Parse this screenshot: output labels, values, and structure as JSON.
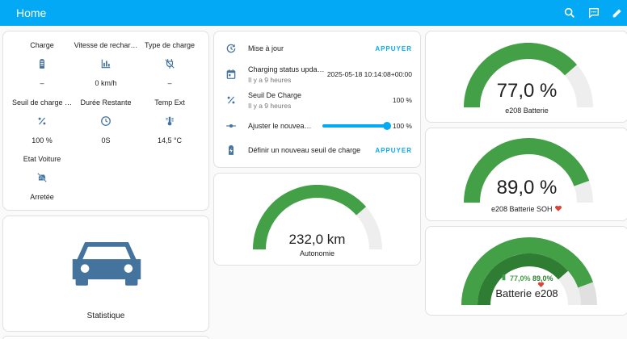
{
  "header": {
    "title": "Home",
    "icons": [
      "search-icon",
      "assist-icon",
      "edit-icon"
    ]
  },
  "status_grid": [
    {
      "label": "Charge",
      "icon": "battery-icon",
      "value": "–"
    },
    {
      "label": "Vitesse de rechar…",
      "icon": "chart-bar-icon",
      "value": "0 km/h"
    },
    {
      "label": "Type de charge",
      "icon": "power-plug-off-icon",
      "value": "–"
    },
    {
      "label": "Seuil de charge …",
      "icon": "percent-icon",
      "value": "100 %"
    },
    {
      "label": "Durée Restante",
      "icon": "clock-icon",
      "value": "0S"
    },
    {
      "label": "Temp Ext",
      "icon": "thermometer-icon",
      "value": "14,5 °C"
    },
    {
      "label": "Etat Voiture",
      "icon": "car-off-icon",
      "value": "Arretée"
    }
  ],
  "statistics": {
    "label": "Statistique",
    "icon": "car-icon"
  },
  "entities": {
    "update": {
      "name": "Mise à jour",
      "button": "APPUYER"
    },
    "charging_status": {
      "name": "Charging status upda…",
      "sub": "Il y a 9 heures",
      "value": "2025-05-18 10:14:08+00:00"
    },
    "threshold": {
      "name": "Seuil De Charge",
      "sub": "Il y a 9 heures",
      "value": "100 %"
    },
    "slider": {
      "name": "Ajuster le nouveau …",
      "value": "100 %",
      "level": 1.0
    },
    "set_threshold": {
      "name": "Définir un nouveau seuil de charge",
      "button": "APPUYER"
    }
  },
  "gauges": {
    "autonomie": {
      "value": "232,0 km",
      "name": "Autonomie",
      "fraction": 0.77
    },
    "battery": {
      "value": "77,0 %",
      "name": "e208 Batterie",
      "fraction": 0.77
    },
    "soh": {
      "value": "89,0 %",
      "name": "e208 Batterie SOH",
      "fraction": 0.89
    },
    "combined": {
      "name": "Batterie e208",
      "label_a": "77,0%",
      "label_b": "89,0%",
      "outer_fraction": 0.89,
      "inner_fraction": 0.77
    }
  },
  "colors": {
    "header": "#03a9f4",
    "gauge": "#43a047",
    "gauge_dark": "#2e7d32",
    "track": "#eeeeee",
    "icon": "#44739e",
    "heart": "#db4437"
  }
}
